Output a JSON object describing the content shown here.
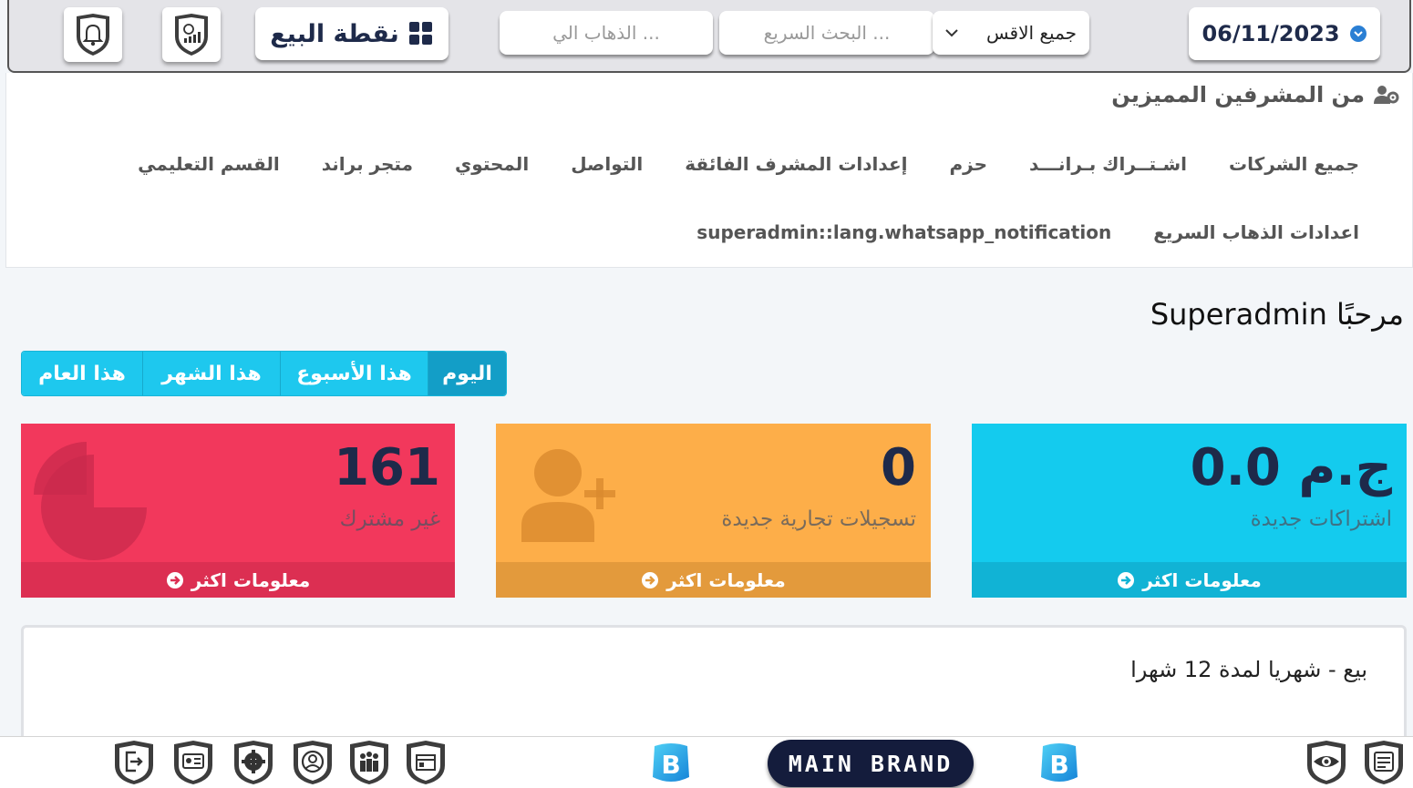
{
  "topbar": {
    "pos_label": "نقطة البيع",
    "goto_placeholder": "الذهاب الي ...",
    "search_placeholder": "البحث السريع ...",
    "location_selected": "جميع الاقس",
    "date": "06/11/2023"
  },
  "panel": {
    "title": "من المشرفين المميزين",
    "nav_row1": [
      "جميع الشركات",
      "اشـتــراك بـرانـــد",
      "حزم",
      "إعدادات المشرف الفائقة",
      "التواصل",
      "المحتوي",
      "متجر براند",
      "القسم التعليمي"
    ],
    "nav_row2": [
      "اعدادات الذهاب السريع",
      "superadmin::lang.whatsapp_notification"
    ]
  },
  "welcome": "مرحبًا Superadmin",
  "tabs": [
    "اليوم",
    "هذا الأسبوع",
    "هذا الشهر",
    "هذا العام"
  ],
  "cards": {
    "subscriptions": {
      "value": "ج.م 0.0",
      "label": "اشتراكات جديدة",
      "more": "معلومات اكثر"
    },
    "registrations": {
      "value": "0",
      "label": "تسجيلات تجارية جديدة",
      "more": "معلومات اكثر"
    },
    "not_subscribed": {
      "value": "161",
      "label": "غير مشترك",
      "more": "معلومات اكثر"
    }
  },
  "chart_title": "بيع - شهريا لمدة 12 شهرا",
  "footer": {
    "brand": "MAIN BRAND",
    "brand_letter": "B"
  },
  "colors": {
    "cyan": "#14cbee",
    "orange": "#fdae49",
    "red": "#f2385c",
    "navy": "#1e2a4a"
  },
  "icons": [
    "bell-icon",
    "money-chart-icon",
    "grid-icon",
    "chevron-down-icon",
    "calendar-icon",
    "users-gear-icon",
    "logout-icon",
    "id-card-icon",
    "gear-icon",
    "user-circle-icon",
    "team-icon",
    "box-icon",
    "eye-icon",
    "list-icon"
  ]
}
